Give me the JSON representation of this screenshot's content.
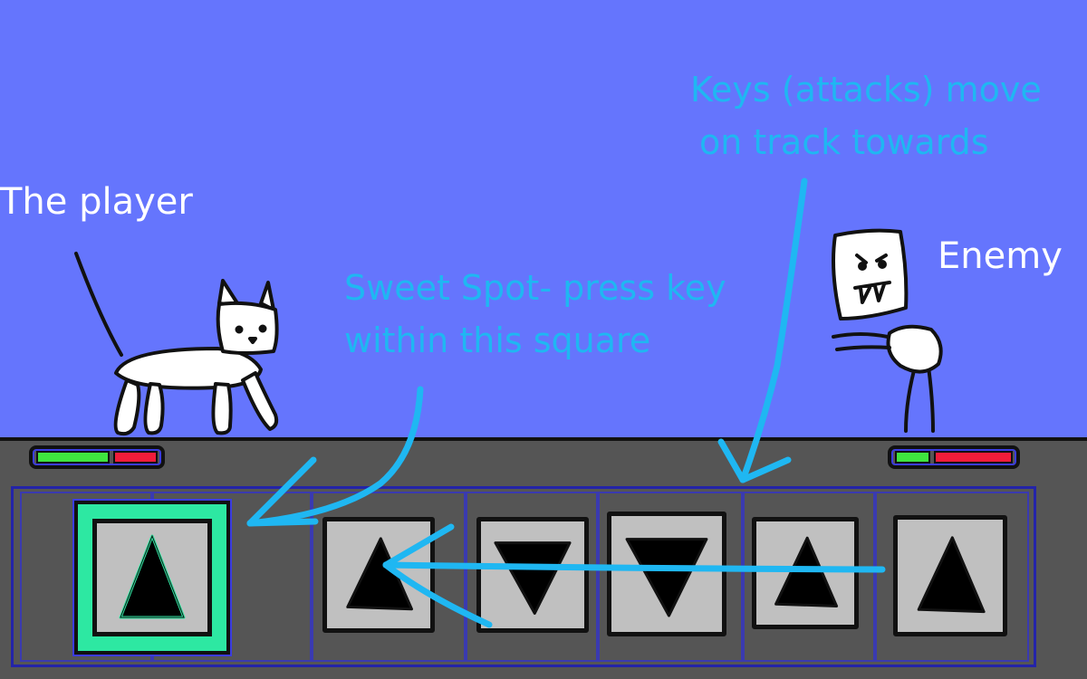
{
  "labels": {
    "player": "The player",
    "enemy": "Enemy",
    "sweet_spot_line1": "Sweet Spot- press key",
    "sweet_spot_line2": "within this square",
    "keys_line1": "Keys (attacks) move",
    "keys_line2": "on track towards"
  },
  "player_health": {
    "hp_fraction": 0.63
  },
  "enemy_health": {
    "hp_fraction": 0.3
  },
  "sweet_spot_key": "up",
  "track_keys": [
    "up",
    "down",
    "down",
    "up",
    "up"
  ],
  "colors": {
    "sky": "#6575fd",
    "floor": "#555555",
    "annotation": "#1fb7f2",
    "sweet_spot": "#2de8a2",
    "hp_green": "#3fe43f",
    "hp_red": "#f11c3a"
  }
}
